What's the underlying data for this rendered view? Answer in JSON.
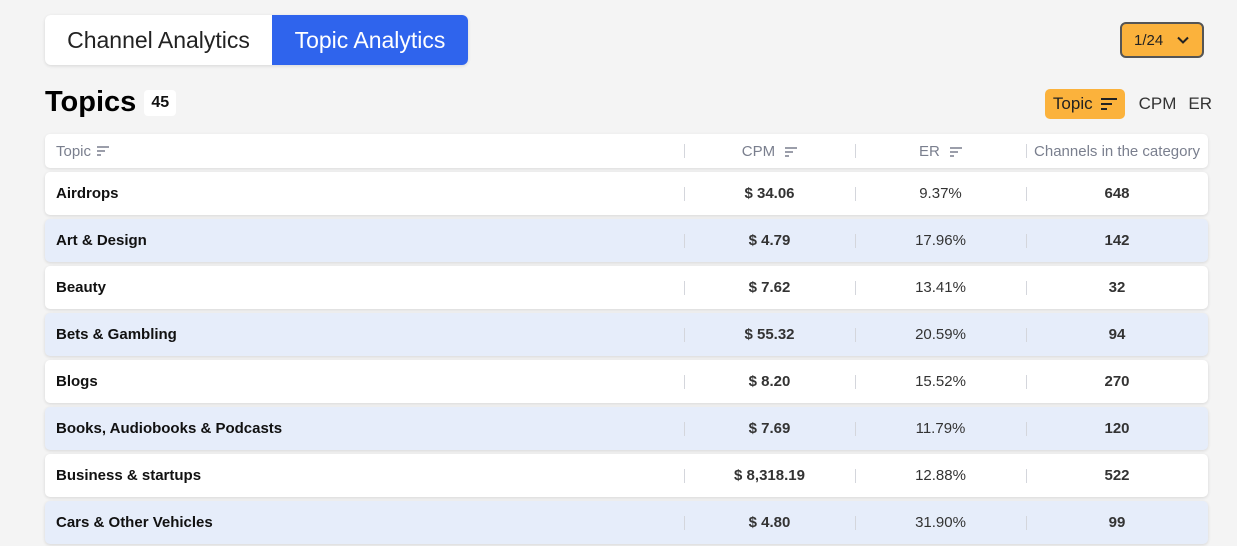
{
  "tabs": [
    {
      "label": "Channel Analytics",
      "active": false
    },
    {
      "label": "Topic Analytics",
      "active": true
    }
  ],
  "pagination": {
    "value": "1/24",
    "icon": "chevron-down-icon"
  },
  "title": "Topics",
  "count": "45",
  "sort_buttons": [
    {
      "label": "Topic",
      "active": true
    },
    {
      "label": "CPM",
      "active": false
    },
    {
      "label": "ER",
      "active": false
    }
  ],
  "table": {
    "headers": [
      "Topic",
      "CPM",
      "ER",
      "Channels in the category"
    ],
    "rows": [
      {
        "topic": "Airdrops",
        "cpm": "$ 34.06",
        "er": "9.37%",
        "channels": "648"
      },
      {
        "topic": "Art & Design",
        "cpm": "$ 4.79",
        "er": "17.96%",
        "channels": "142"
      },
      {
        "topic": "Beauty",
        "cpm": "$ 7.62",
        "er": "13.41%",
        "channels": "32"
      },
      {
        "topic": "Bets & Gambling",
        "cpm": "$ 55.32",
        "er": "20.59%",
        "channels": "94"
      },
      {
        "topic": "Blogs",
        "cpm": "$ 8.20",
        "er": "15.52%",
        "channels": "270"
      },
      {
        "topic": "Books, Audiobooks & Podcasts",
        "cpm": "$ 7.69",
        "er": "11.79%",
        "channels": "120"
      },
      {
        "topic": "Business & startups",
        "cpm": "$ 8,318.19",
        "er": "12.88%",
        "channels": "522"
      },
      {
        "topic": "Cars & Other Vehicles",
        "cpm": "$ 4.80",
        "er": "31.90%",
        "channels": "99"
      }
    ]
  },
  "colors": {
    "accent": "#2f64ed",
    "highlight": "#fbb23c",
    "row_alt": "#e6edfa"
  }
}
